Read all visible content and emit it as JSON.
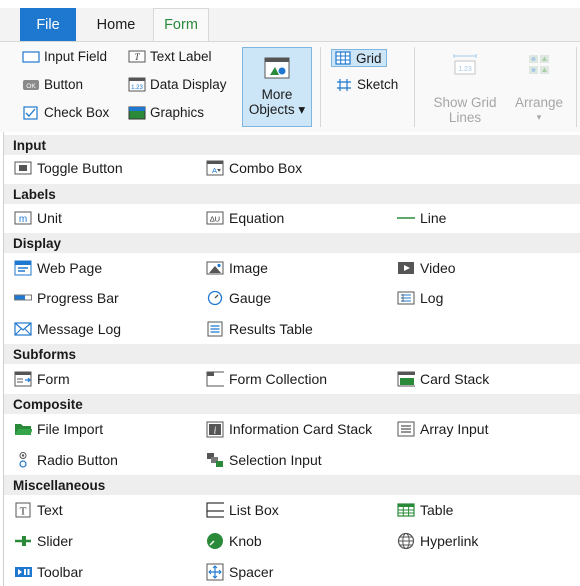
{
  "tabs": {
    "file": "File",
    "home": "Home",
    "form": "Form"
  },
  "ribbon": {
    "input_field": "Input Field",
    "text_label": "Text Label",
    "button": "Button",
    "data_display": "Data Display",
    "check_box": "Check Box",
    "graphics": "Graphics",
    "more_objects_line1": "More",
    "more_objects_line2": "Objects",
    "grid": "Grid",
    "sketch": "Sketch",
    "show_grid_lines_line1": "Show Grid",
    "show_grid_lines_line2": "Lines",
    "arrange": "Arrange"
  },
  "sections": {
    "input": "Input",
    "labels": "Labels",
    "display": "Display",
    "subforms": "Subforms",
    "composite": "Composite",
    "misc": "Miscellaneous"
  },
  "items": {
    "toggle_button": "Toggle Button",
    "combo_box": "Combo Box",
    "unit": "Unit",
    "equation": "Equation",
    "line": "Line",
    "web_page": "Web Page",
    "image": "Image",
    "video": "Video",
    "progress_bar": "Progress Bar",
    "gauge": "Gauge",
    "log": "Log",
    "message_log": "Message Log",
    "results_table": "Results Table",
    "form": "Form",
    "form_collection": "Form Collection",
    "card_stack": "Card Stack",
    "file_import": "File Import",
    "information_card_stack": "Information Card Stack",
    "array_input": "Array Input",
    "radio_button": "Radio Button",
    "selection_input": "Selection Input",
    "text": "Text",
    "list_box": "List Box",
    "table": "Table",
    "slider": "Slider",
    "knob": "Knob",
    "hyperlink": "Hyperlink",
    "toolbar": "Toolbar",
    "spacer": "Spacer"
  },
  "icon_text": {
    "unit": "m",
    "equation": "∆U",
    "text": "T",
    "info": "i",
    "log_count": "1.23"
  },
  "colors": {
    "file_tab": "#1e78cf",
    "form_tab": "#2a8a3a",
    "accent_blue": "#1e78cf",
    "section_bg": "#eeeeee",
    "selected_bg": "#cde6f7"
  }
}
